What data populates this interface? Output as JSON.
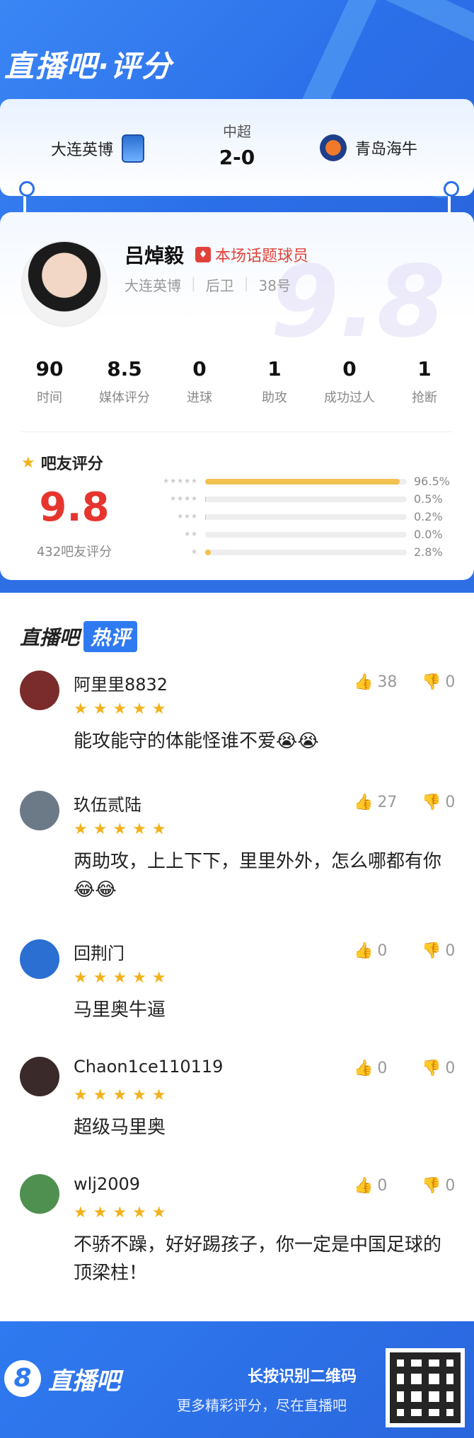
{
  "brand": {
    "title": "直播吧·评分"
  },
  "match": {
    "home": "大连英博",
    "away": "青岛海牛",
    "league": "中超",
    "score": "2-0"
  },
  "player": {
    "name": "吕焯毅",
    "hot_tag": "本场话题球员",
    "team": "大连英博",
    "position": "后卫",
    "number": "38号",
    "big_rating": "9.8"
  },
  "stats": [
    {
      "value": "90",
      "label": "时间"
    },
    {
      "value": "8.5",
      "label": "媒体评分"
    },
    {
      "value": "0",
      "label": "进球"
    },
    {
      "value": "1",
      "label": "助攻"
    },
    {
      "value": "0",
      "label": "成功过人"
    },
    {
      "value": "1",
      "label": "抢断"
    }
  ],
  "fan_rating": {
    "title": "吧友评分",
    "score": "9.8",
    "count_text": "432吧友评分",
    "distribution": [
      {
        "stars": "★★★★★",
        "pct": "96.5%",
        "fraction": 0.965
      },
      {
        "stars": "★★★★",
        "pct": "0.5%",
        "fraction": 0.005
      },
      {
        "stars": "★★★",
        "pct": "0.2%",
        "fraction": 0.002
      },
      {
        "stars": "★★",
        "pct": "0.0%",
        "fraction": 0.0
      },
      {
        "stars": "★",
        "pct": "2.8%",
        "fraction": 0.028
      }
    ]
  },
  "hot_comments": {
    "title_prefix": "直播吧",
    "title_box": "热评",
    "items": [
      {
        "user": "阿里里8832",
        "stars": "★★★★★",
        "text": "能攻能守的体能怪谁不爱😭😭",
        "likes": "38",
        "dislikes": "0",
        "avatar_color": "#7a2b2b"
      },
      {
        "user": "玖伍贰陆",
        "stars": "★★★★★",
        "text": "两助攻，上上下下，里里外外，怎么哪都有你😂😂",
        "likes": "27",
        "dislikes": "0",
        "avatar_color": "#6b7a86"
      },
      {
        "user": "回荆门",
        "stars": "★★★★★",
        "text": "马里奥牛逼",
        "likes": "0",
        "dislikes": "0",
        "avatar_color": "#2a6fd1"
      },
      {
        "user": "Chaon1ce110119",
        "stars": "★★★★★",
        "text": "超级马里奥",
        "likes": "0",
        "dislikes": "0",
        "avatar_color": "#3a2a2a"
      },
      {
        "user": "wlj2009",
        "stars": "★★★★★",
        "text": "不骄不躁，好好踢孩子，你一定是中国足球的顶梁柱！",
        "likes": "0",
        "dislikes": "0",
        "avatar_color": "#4f8f4f"
      }
    ]
  },
  "footer": {
    "logo_text": "直播吧",
    "logo_badge": "8",
    "line1": "长按识别二维码",
    "line2": "更多精彩评分，尽在直播吧"
  }
}
